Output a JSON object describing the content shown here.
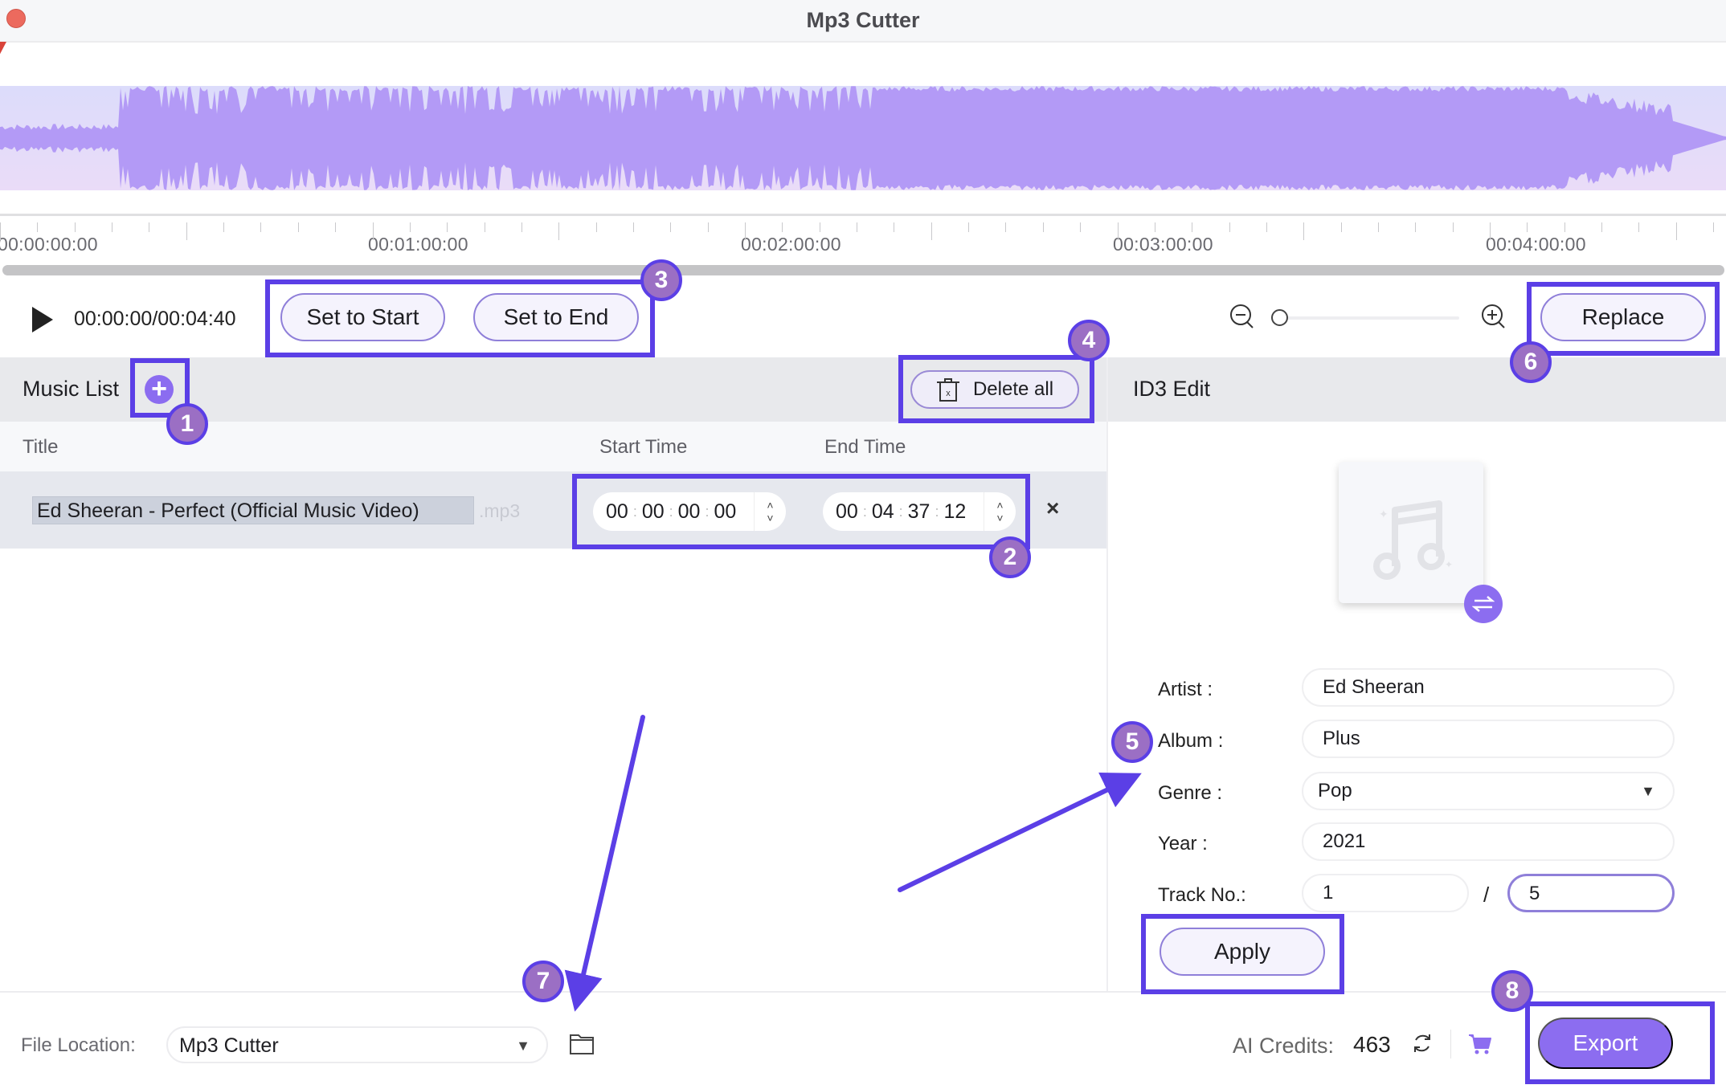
{
  "window": {
    "title": "Mp3 Cutter"
  },
  "timeline": {
    "labels": [
      "00:00:00:00",
      "00:01:00:00",
      "00:02:00:00",
      "00:03:00:00",
      "00:04:00:00"
    ]
  },
  "toolbar": {
    "time_readout": "00:00:00/00:04:40",
    "set_start_label": "Set to Start",
    "set_end_label": "Set to End",
    "replace_label": "Replace",
    "zoom_level": 0
  },
  "music_list": {
    "title": "Music List",
    "delete_all_label": "Delete all",
    "columns": {
      "title": "Title",
      "start": "Start Time",
      "end": "End Time"
    },
    "rows": [
      {
        "title": "Ed Sheeran - Perfect (Official Music Video)",
        "extension": ".mp3",
        "start": [
          "00",
          "00",
          "00",
          "00"
        ],
        "end": [
          "00",
          "04",
          "37",
          "12"
        ]
      }
    ]
  },
  "id3": {
    "title": "ID3 Edit",
    "artist_label": "Artist :",
    "artist": "Ed Sheeran",
    "album_label": "Album :",
    "album": "Plus",
    "genre_label": "Genre :",
    "genre": "Pop",
    "year_label": "Year :",
    "year": "2021",
    "track_label": "Track No.:",
    "track": "1",
    "track_sep": "/",
    "track_total": "5",
    "apply_label": "Apply"
  },
  "footer": {
    "file_location_label": "File Location:",
    "file_location": "Mp3 Cutter",
    "credits_label": "AI Credits:",
    "credits_value": "463",
    "export_label": "Export"
  },
  "annotations": [
    "1",
    "2",
    "3",
    "4",
    "5",
    "6",
    "7",
    "8"
  ],
  "icons": {
    "close": "×",
    "chevron_down": "⌄",
    "stepper_up": "˄",
    "stepper_down": "˅"
  },
  "colors": {
    "accent": "#8c6df0",
    "annotation": "#5b3fe6",
    "badge": "#9b6fc4"
  }
}
